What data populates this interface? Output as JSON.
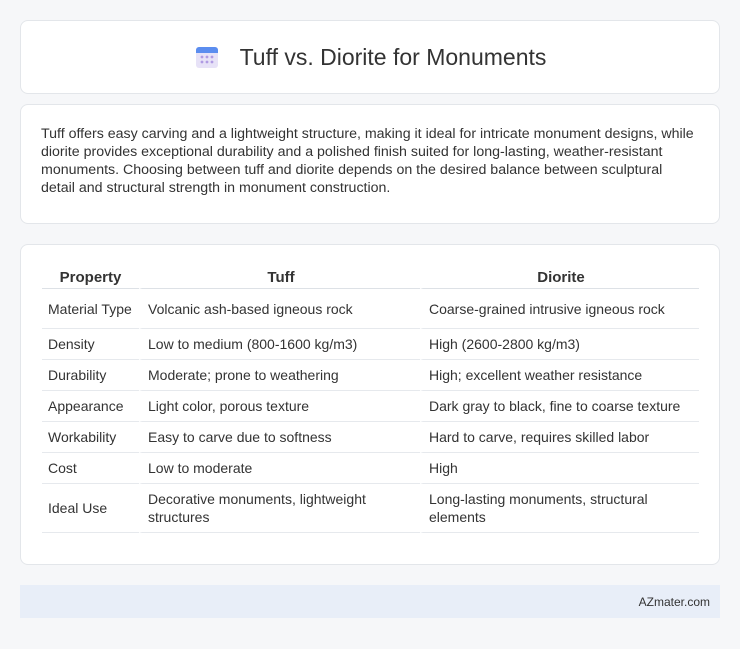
{
  "header": {
    "title": "Tuff vs. Diorite for Monuments",
    "icon": "calendar-icon"
  },
  "intro": {
    "text": "Tuff offers easy carving and a lightweight structure, making it ideal for intricate monument designs, while diorite provides exceptional durability and a polished finish suited for long-lasting, weather-resistant monuments. Choosing between tuff and diorite depends on the desired balance between sculptural detail and structural strength in monument construction."
  },
  "table": {
    "headers": [
      "Property",
      "Tuff",
      "Diorite"
    ],
    "rows": [
      [
        "Material Type",
        "Volcanic ash-based igneous rock",
        "Coarse-grained intrusive igneous rock"
      ],
      [
        "Density",
        "Low to medium (800-1600 kg/m3)",
        "High (2600-2800 kg/m3)"
      ],
      [
        "Durability",
        "Moderate; prone to weathering",
        "High; excellent weather resistance"
      ],
      [
        "Appearance",
        "Light color, porous texture",
        "Dark gray to black, fine to coarse texture"
      ],
      [
        "Workability",
        "Easy to carve due to softness",
        "Hard to carve, requires skilled labor"
      ],
      [
        "Cost",
        "Low to moderate",
        "High"
      ],
      [
        "Ideal Use",
        "Decorative monuments, lightweight structures",
        "Long-lasting monuments, structural elements"
      ]
    ]
  },
  "footer": {
    "text": "AZmater.com"
  },
  "colors": {
    "page_background": "#f6f7f9",
    "card_background": "#ffffff",
    "footer_background": "#e8eef8",
    "icon_blue": "#5b8def",
    "icon_purple": "#b9a6e8"
  }
}
